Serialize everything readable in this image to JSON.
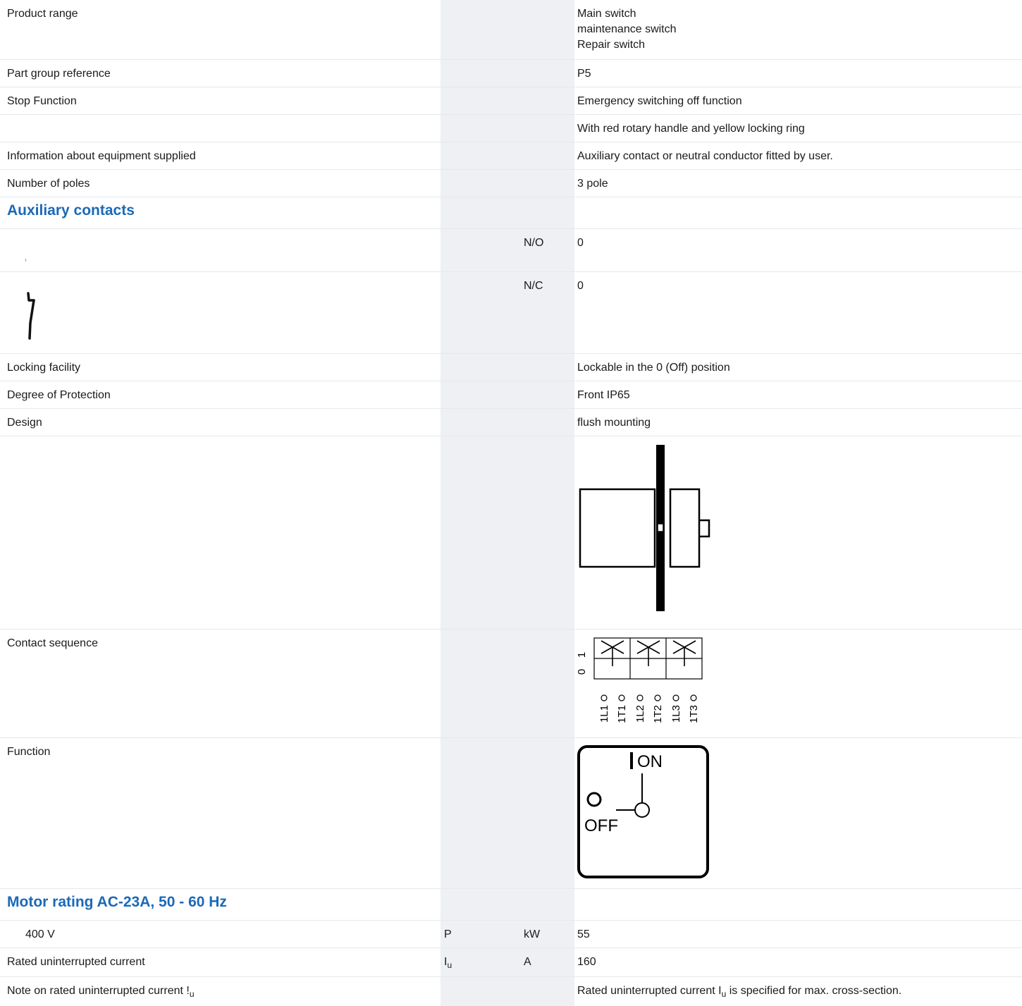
{
  "rows": {
    "product_range": {
      "label": "Product range",
      "values": [
        "Main switch",
        "maintenance switch",
        "Repair switch"
      ]
    },
    "part_group": {
      "label": "Part group reference",
      "value": "P5"
    },
    "stop_function": {
      "label": "Stop Function",
      "value": "Emergency switching off function"
    },
    "handle": {
      "label": "",
      "value": "With red rotary handle and yellow locking ring"
    },
    "equipment_info": {
      "label": "Information about equipment supplied",
      "value": "Auxiliary contact or neutral conductor fitted by user."
    },
    "poles": {
      "label": "Number of poles",
      "value": "3 pole"
    },
    "aux_heading": "Auxiliary contacts",
    "no": {
      "symbol": "N/O",
      "value": "0"
    },
    "nc": {
      "symbol": "N/C",
      "value": "0"
    },
    "locking": {
      "label": "Locking facility",
      "value": "Lockable in the 0 (Off) position"
    },
    "protection": {
      "label": "Degree of Protection",
      "value": "Front IP65"
    },
    "design": {
      "label": "Design",
      "value": "flush mounting"
    },
    "contact_sequence": {
      "label": "Contact sequence",
      "positions": [
        "1",
        "0"
      ],
      "terminals": [
        "1L1",
        "1T1",
        "1L2",
        "1T2",
        "1L3",
        "1T3"
      ]
    },
    "function": {
      "label": "Function",
      "on_label": "ON",
      "off_label": "OFF"
    },
    "motor_heading": "Motor rating AC-23A, 50 - 60 Hz",
    "motor_400v": {
      "label": "400 V",
      "symbol": "P",
      "unit": "kW",
      "value": "55"
    },
    "rated_current": {
      "label": "Rated uninterrupted current",
      "symbol_main": "I",
      "symbol_sub": "u",
      "unit": "A",
      "value": "160"
    },
    "note": {
      "label_main": "Note on rated uninterrupted current !",
      "label_sub": "u",
      "value_main": "Rated uninterrupted current I",
      "value_sub": "u",
      "value_rest": " is specified for max. cross-section."
    }
  },
  "colors": {
    "heading": "#1b69b8",
    "shaded_column": "#eef0f4",
    "row_divider": "#e6e8ec"
  }
}
